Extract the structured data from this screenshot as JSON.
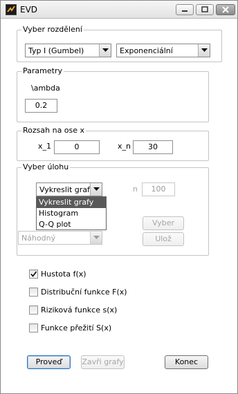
{
  "window": {
    "title": "EVD"
  },
  "distribution": {
    "legend": "Vyber rozdělení",
    "type_select": "Typ I (Gumbel)",
    "family_select": "Exponenciální"
  },
  "parameters": {
    "legend": "Parametry",
    "param_label": "\\ambda",
    "param_value": "0.2"
  },
  "range": {
    "legend": "Rozsah na ose x",
    "x1_label": "x_1",
    "x1_value": "0",
    "xn_label": "x_n",
    "xn_value": "30"
  },
  "task": {
    "legend": "Vyber úlohu",
    "task_select": "Vykreslit grafy",
    "n_label": "n",
    "n_value": "100",
    "sample_select": "Náhodný",
    "choose_button": "Vyber",
    "save_button": "Ulož",
    "dropdown_options": [
      "Vykreslit grafy",
      "Histogram",
      "Q-Q plot"
    ]
  },
  "checkboxes": [
    {
      "label": "Hustota f(x)",
      "checked": true
    },
    {
      "label": "Distribuční funkce F(x)",
      "checked": false
    },
    {
      "label": "Riziková funkce s(x)",
      "checked": false
    },
    {
      "label": "Funkce přežití S(x)",
      "checked": false
    }
  ],
  "footer": {
    "run_button": "Proveď",
    "close_graphs_button": "Zavři grafy",
    "end_button": "Konec"
  }
}
